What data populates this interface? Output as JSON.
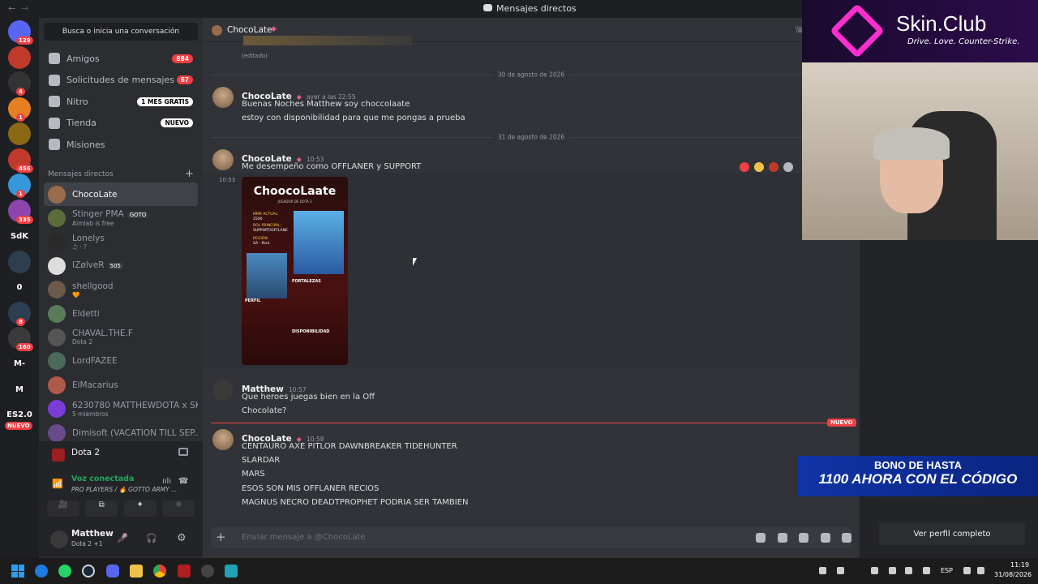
{
  "window": {
    "title": "Mensajes directos"
  },
  "servers": {
    "badges": [
      "129",
      "4",
      "1",
      "456",
      "1",
      "335",
      "8",
      "160"
    ],
    "labels": [
      "SdK",
      "0",
      "M-",
      "M",
      "ES2.0"
    ],
    "new_label": "NUEVO"
  },
  "sidebar": {
    "search_placeholder": "Busca o inicia una conversación",
    "nav": [
      {
        "label": "Amigos",
        "count": "884",
        "icon": "friends-icon"
      },
      {
        "label": "Solicitudes de mensajes",
        "count": "67",
        "icon": "mail-icon"
      },
      {
        "label": "Nitro",
        "pill": "1 MES GRATIS",
        "icon": "nitro-icon"
      },
      {
        "label": "Tienda",
        "pill": "NUEVO",
        "icon": "shop-icon"
      },
      {
        "label": "Misiones",
        "icon": "quest-icon"
      }
    ],
    "dm_header": "Mensajes directos",
    "dms": [
      {
        "name": "ChocoLate",
        "sub": "",
        "active": true,
        "color": "#9a6b4a"
      },
      {
        "name": "Stinger PMA",
        "tag": "GOTO",
        "sub": "Aimlab is free",
        "color": "#5b6b3a"
      },
      {
        "name": "Lonelys",
        "sub": "♫ · ?",
        "color": "#2a2a2a"
      },
      {
        "name": "IZølveR",
        "tag": "505",
        "sub": "",
        "color": "#ddd"
      },
      {
        "name": "shellgood",
        "sub": "🧡",
        "color": "#6b5a4a"
      },
      {
        "name": "Eldetti",
        "sub": "",
        "color": "#5a7a5a"
      },
      {
        "name": "CHAVAL.THE.F",
        "sub": "Dota 2",
        "color": "#555"
      },
      {
        "name": "LordFAZEE",
        "sub": "",
        "color": "#4a6a5a"
      },
      {
        "name": "ElMacarius",
        "sub": "",
        "color": "#b05a4a"
      },
      {
        "name": "6230780 MATTHEWDOTA x SKI...",
        "sub": "5 miembros",
        "color": "#7b3bd6"
      },
      {
        "name": "Dimisoft (VACATION TILL SEP...",
        "sub": "",
        "color": "#6a4a8a"
      }
    ],
    "voice_server": "Dota 2",
    "voice_status": "Voz conectada",
    "voice_channel": "PRO PLAYERS / 🔥 GOTTO ARMY ...",
    "user_name": "Matthew",
    "user_status": "Dota 2 +1"
  },
  "chat": {
    "header_name": "ChocoLate",
    "edited": "(editado)",
    "date1": "30 de agosto de 2026",
    "date2": "31 de agosto de 2026",
    "new_label": "NUEVO",
    "messages": [
      {
        "author": "ChocoLate",
        "time": "ayer a las 22:55",
        "lines": [
          "Buenas Noches Matthew soy choccolaate",
          "estoy con disponibilidad para que me pongas a prueba"
        ]
      },
      {
        "author": "ChocoLate",
        "time": "10:53",
        "lines": [
          "Me desempeño como OFFLANER y SUPPORT"
        ],
        "side_time": "10:53"
      },
      {
        "author": "Matthew",
        "time": "10:57",
        "lines": [
          "Que heroes juegas bien en la Off",
          "Chocolate?"
        ]
      },
      {
        "author": "ChocoLate",
        "time": "10:58",
        "lines": [
          "CENTAURO AXE PITLOR DAWNBREAKER  TIDEHUNTER",
          "SLARDAR",
          "MARS",
          "ESOS SON MIS OFFLANER RECIOS",
          "MAGNUS NECRO DEADTPROPHET PODRIA SER TAMBIEN"
        ]
      }
    ],
    "card": {
      "title": "ChoocoLaate",
      "subtitle": "JUGADOR DE DOTA 2",
      "mmr_label": "MMR ACTUAL:",
      "mmr": "2500",
      "role_label": "ROL PRINCIPAL:",
      "role": "SUPPORT/OFFLANE",
      "region_label": "REGIÓN:",
      "region": "SA - Perú",
      "strengths": "FORTALEZAS",
      "profile": "PERFIL",
      "availability": "DISPONIBILIDAD"
    },
    "input_placeholder": "Enviar mensaje a @ChocoLate"
  },
  "right": {
    "profile_button": "Ver perfil completo"
  },
  "overlay": {
    "brand": "Skin.Club",
    "tagline": "Drive. Love. Counter-Strike.",
    "promo1": "BONO DE HASTA",
    "promo2": "1100 AHORA CON EL CÓDIGO"
  },
  "taskbar": {
    "lang": "ESP",
    "time": "11:19",
    "date": "31/08/2026"
  }
}
